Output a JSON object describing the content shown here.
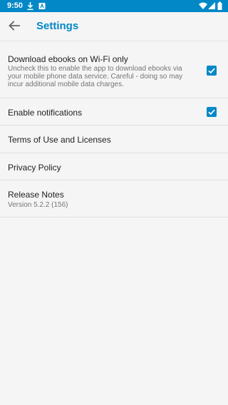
{
  "status_bar": {
    "time": "9:50",
    "icons": [
      "download-icon",
      "notification-icon",
      "wifi-icon",
      "signal-icon",
      "battery-icon"
    ]
  },
  "header": {
    "title": "Settings",
    "back_icon": "arrow-back-icon"
  },
  "settings": [
    {
      "title": "Download ebooks on Wi-Fi only",
      "description": "Uncheck this to enable the app to download ebooks via your mobile phone data service. Careful - doing so may incur additional mobile data charges.",
      "checked": true
    },
    {
      "title": "Enable notifications",
      "checked": true
    },
    {
      "title": "Terms of Use and Licenses"
    },
    {
      "title": "Privacy Policy"
    },
    {
      "title": "Release Notes",
      "description": "Version 5.2.2 (156)"
    }
  ],
  "colors": {
    "accent": "#0288c7",
    "background": "#f5f5f5",
    "divider": "#e0e0e0",
    "text_primary": "#212121",
    "text_secondary": "#757575"
  }
}
